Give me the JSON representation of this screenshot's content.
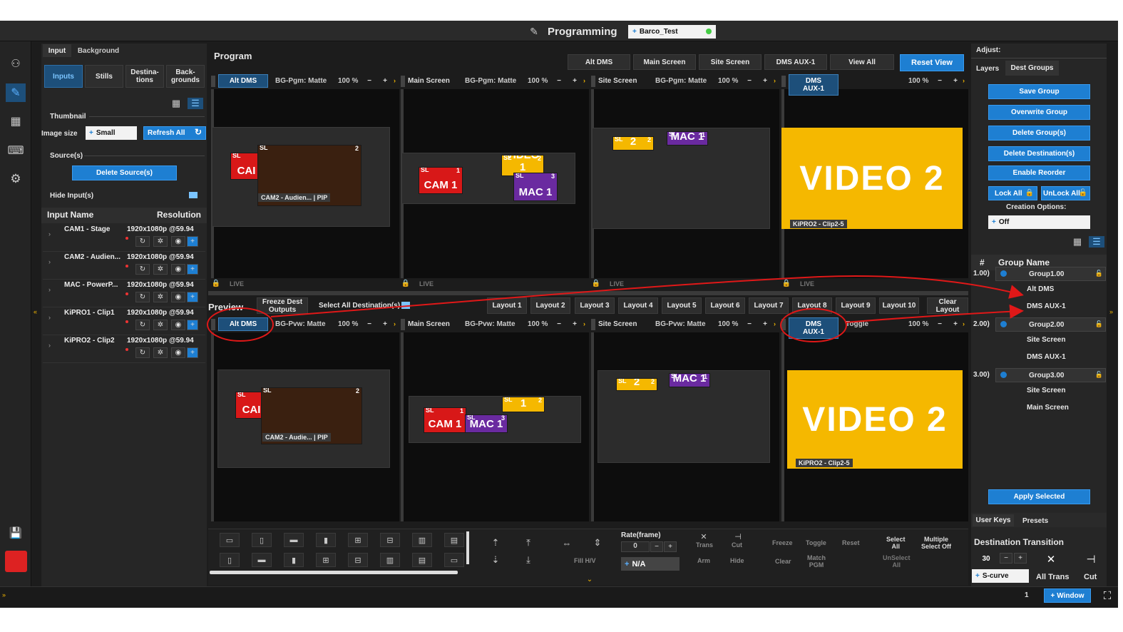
{
  "header": {
    "title": "Programming",
    "preset": "Barco_Test"
  },
  "left_tabs": [
    "Input",
    "Background"
  ],
  "sub_tabs": [
    "Inputs",
    "Stills",
    "Destina-\ntions",
    "Back-\ngrounds"
  ],
  "thumb_label": "Thumbnail",
  "image_size_label": "Image size",
  "image_size_value": "Small",
  "refresh_label": "Refresh All",
  "sources_label": "Source(s)",
  "delete_sources": "Delete Source(s)",
  "hide_inputs": "Hide Input(s)",
  "input_header": {
    "name": "Input Name",
    "res": "Resolution"
  },
  "inputs": [
    {
      "name": "CAM1 - Stage",
      "res": "1920x1080p @59.94"
    },
    {
      "name": "CAM2 - Audien...",
      "res": "1920x1080p @59.94"
    },
    {
      "name": "MAC - PowerP...",
      "res": "1920x1080p @59.94"
    },
    {
      "name": "KiPRO1 - Clip1",
      "res": "1920x1080p @59.94"
    },
    {
      "name": "KiPRO2 - Clip2",
      "res": "1920x1080p @59.94"
    }
  ],
  "program": {
    "label": "Program",
    "views": [
      "Alt DMS",
      "Main Screen",
      "Site Screen",
      "DMS AUX-1",
      "View All"
    ],
    "reset": "Reset View"
  },
  "dest_pgm": [
    {
      "name": "Alt DMS",
      "bg": "BG-Pgm: Matte",
      "zoom": "100 %"
    },
    {
      "name": "Main Screen",
      "bg": "BG-Pgm: Matte",
      "zoom": "100 %"
    },
    {
      "name": "Site Screen",
      "bg": "BG-Pgm: Matte",
      "zoom": "100 %"
    },
    {
      "name": "DMS AUX-1",
      "bg": "",
      "zoom": "100 %"
    }
  ],
  "dest_pvw": [
    {
      "name": "Alt DMS",
      "bg": "BG-Pvw: Matte",
      "zoom": "100 %"
    },
    {
      "name": "Main Screen",
      "bg": "BG-Pvw: Matte",
      "zoom": "100 %"
    },
    {
      "name": "Site Screen",
      "bg": "BG-Pvw: Matte",
      "zoom": "100 %"
    },
    {
      "name": "DMS AUX-1",
      "bg": "Toggle",
      "zoom": "100 %"
    }
  ],
  "tiles": {
    "sl": "SL",
    "cam1": "CAM 1",
    "cam1short": "CAI",
    "video1": "VIDEO 1",
    "video2": "VIDEO 2",
    "mac1": "MAC 1",
    "cap_cam2": "CAM2 - Audien...  | PIP",
    "cap_cam2b": "CAM2 - Audie...  | PIP",
    "cap_kipro": "KiPRO2 - Clip2-5",
    "live": "LIVE",
    "n1": "1",
    "n2": "2",
    "n3": "3"
  },
  "preview": {
    "label": "Preview",
    "freeze": "Freeze Dest\nOutputs",
    "select_all": "Select All Destination(s)",
    "layouts": [
      "Layout 1",
      "Layout 2",
      "Layout 3",
      "Layout 4",
      "Layout 5",
      "Layout 6",
      "Layout 7",
      "Layout 8",
      "Layout 9",
      "Layout 10"
    ],
    "clear": "Clear\nLayout"
  },
  "bottom": {
    "rate": "Rate(frame)",
    "rate_val": "0",
    "na": "N/A",
    "fill": "Fill H/V",
    "trans": "Trans",
    "cut": "Cut",
    "arm": "Arm",
    "hide": "Hide",
    "freeze": "Freeze",
    "toggle": "Toggle",
    "reset": "Reset",
    "clear": "Clear",
    "match": "Match\nPGM",
    "select_all": "Select\nAll",
    "unselect": "UnSelect\nAll",
    "multi": "Multiple\nSelect Off"
  },
  "adjust": {
    "label": "Adjust:",
    "tabs": [
      "Layers",
      "Dest Groups"
    ],
    "buttons": [
      "Save Group",
      "Overwrite Group",
      "Delete Group(s)",
      "Delete Destination(s)",
      "Enable Reorder"
    ],
    "lock": "Lock All",
    "unlock": "UnLock All",
    "creation": "Creation Options:",
    "creation_val": "Off",
    "col_num": "#",
    "col_name": "Group Name",
    "groups": [
      {
        "num": "1.00)",
        "name": "Group1.00",
        "members": [
          "Alt DMS",
          "DMS AUX-1"
        ]
      },
      {
        "num": "2.00)",
        "name": "Group2.00",
        "members": [
          "Site Screen",
          "DMS AUX-1"
        ]
      },
      {
        "num": "3.00)",
        "name": "Group3.00",
        "members": [
          "Site Screen",
          "Main Screen"
        ]
      }
    ],
    "apply": "Apply Selected",
    "user_keys": "User Keys",
    "presets": "Presets",
    "dest_trans": "Destination Transition",
    "trans_val": "30",
    "curve": "S-curve",
    "all_trans": "All Trans",
    "cut": "Cut"
  },
  "footer": {
    "page": "1",
    "window": "Window"
  },
  "colors": {
    "accent": "#1e7fd2",
    "highlight": "#f5b800",
    "annotation": "#e01818"
  }
}
